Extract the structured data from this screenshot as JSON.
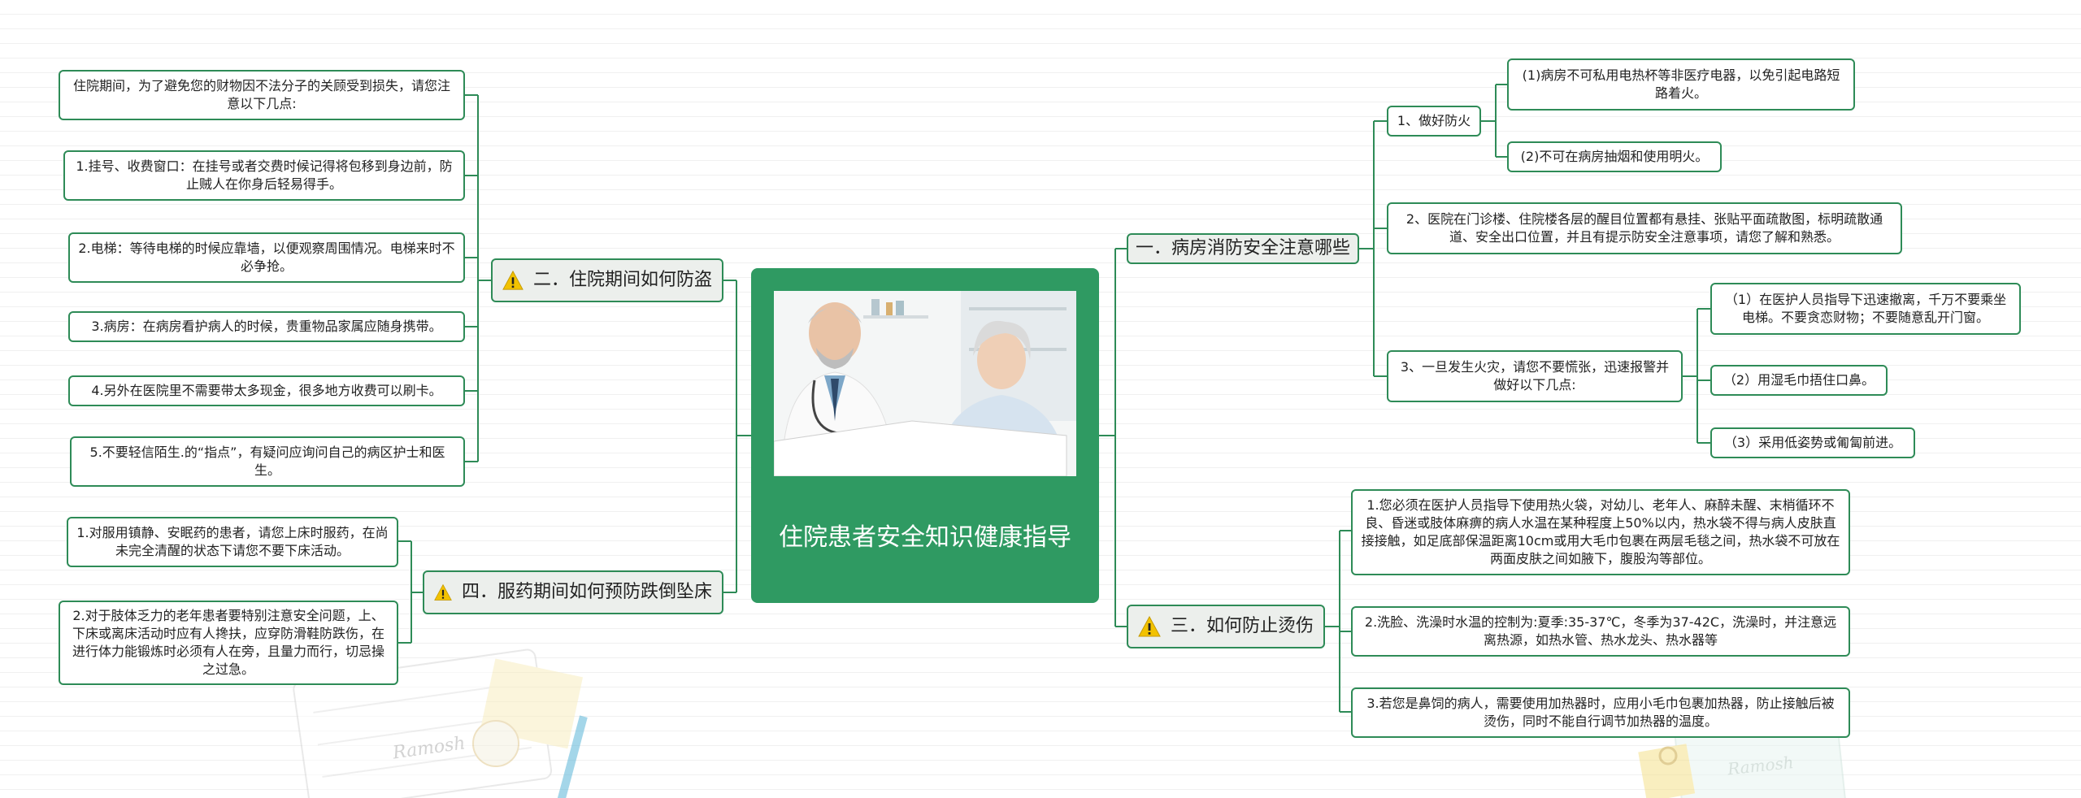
{
  "root": {
    "title": "住院患者安全知识健康指导",
    "photo": "doctor-and-patient-photo"
  },
  "topics": [
    {
      "label": "一．病房消防安全注意哪些",
      "icon": ""
    },
    {
      "label": "二．住院期间如何防盗",
      "icon": "warning-icon"
    },
    {
      "label": "三．如何防止烫伤",
      "icon": "warning-icon"
    },
    {
      "label": "四．服药期间如何预防跌倒坠床",
      "icon": "warning-icon"
    }
  ],
  "fire": {
    "a": "1、做好防火",
    "a1": "(1)病房不可私用电热杯等非医疗电器，以免引起电路短路着火。",
    "a2": "(2)不可在病房抽烟和使用明火。",
    "b": "2、医院在门诊楼、住院楼各层的醒目位置都有悬挂、张贴平面疏散图，标明疏散通道、安全出口位置，并且有提示防安全注意事项，请您了解和熟悉。",
    "c": "3、一旦发生火灾，请您不要慌张，迅速报警并做好以下几点:",
    "c1": "（1）在医护人员指导下迅速撤离，千万不要乘坐电梯。不要贪恋财物；不要随意乱开门窗。",
    "c2": "（2）用湿毛巾捂住口鼻。",
    "c3": "（3）采用低姿势或匍匐前进。"
  },
  "theft": [
    "住院期间，为了避免您的财物因不法分子的关顾受到损失，请您注意以下几点:",
    "1.挂号、收费窗口：在挂号或者交费时候记得将包移到身边前，防止贼人在你身后轻易得手。",
    "2.电梯：等待电梯的时候应靠墙，以便观察周围情况。电梯来时不必争抢。",
    "3.病房：在病房看护病人的时候，贵重物品家属应随身携带。",
    "4.另外在医院里不需要带太多现金，很多地方收费可以刷卡。",
    "5.不要轻信陌生.的“指点”，有疑问应询问自己的病区护士和医生。"
  ],
  "burn": [
    "1.您必须在医护人员指导下使用热火袋，对幼儿、老年人、麻醉未醒、末梢循环不良、昏迷或肢体麻痹的病人水温在某种程度上50%以内，热水袋不得与病人皮肤直接接触，如足底部保温距离10cm或用大毛巾包裹在两层毛毯之间，热水袋不可放在两面皮肤之间如腋下，腹股沟等部位。",
    "2.洗脸、洗澡时水温的控制为:夏季:35-37℃，冬季为37-42C，洗澡时，并注意远离热源，如热水管、热水龙头、热水器等",
    "3.若您是鼻饲的病人，需要使用加热器时，应用小毛巾包裹加热器，防止接触后被烫伤，同时不能自行调节加热器的温度。"
  ],
  "fall": [
    "1.对服用镇静、安眠药的患者，请您上床时服药，在尚未完全清醒的状态下请您不要下床活动。",
    "2.对于肢体乏力的老年患者要特别注意安全问题，上、下床或离床活动时应有人搀扶，应穿防滑鞋防跌伤，在进行体力能锻炼时必须有人在旁，且量力而行，切忌操之过急。"
  ],
  "decor": {
    "watermark": "Ramosh"
  },
  "colors": {
    "accent": "#2e8b57",
    "center_bg": "#2f9a62",
    "topic_bg": "#ecefec",
    "warning": "#f2c200"
  }
}
